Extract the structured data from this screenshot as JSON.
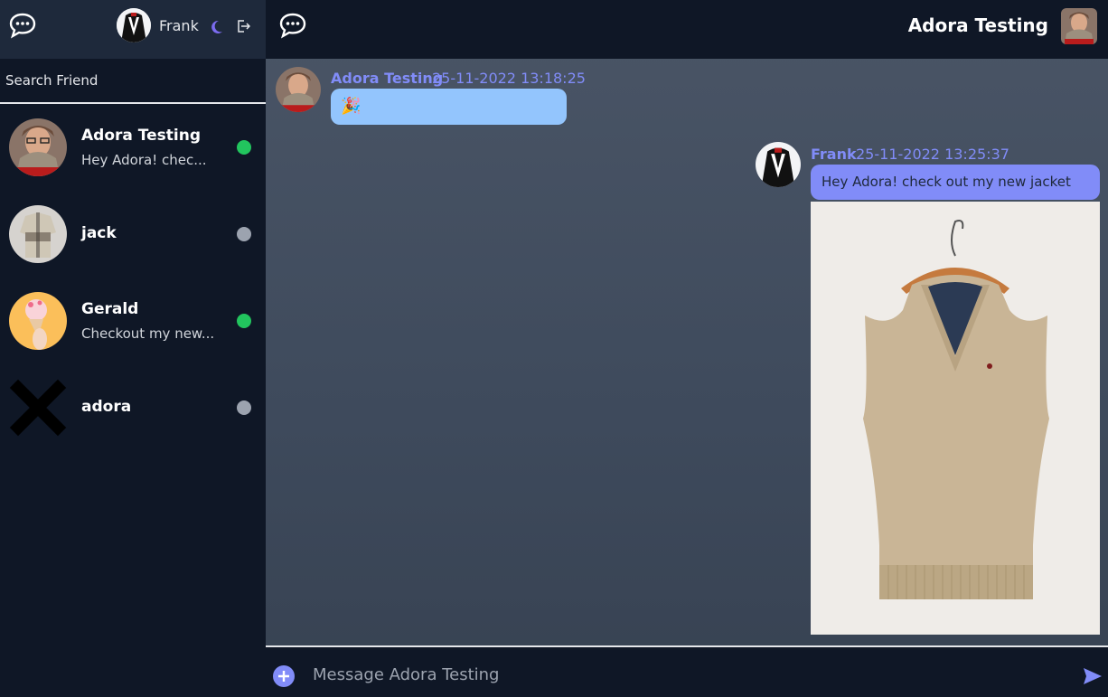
{
  "current_user": {
    "name": "Frank"
  },
  "search": {
    "placeholder": "Search Friend"
  },
  "contacts": [
    {
      "name": "Adora Testing",
      "preview": "Hey Adora! chec...",
      "status": "online"
    },
    {
      "name": "jack",
      "preview": "",
      "status": "offline"
    },
    {
      "name": "Gerald",
      "preview": "Checkout my new...",
      "status": "online"
    },
    {
      "name": "adora",
      "preview": "",
      "status": "offline"
    }
  ],
  "chat": {
    "title": "Adora Testing",
    "messages": [
      {
        "sender": "Adora Testing",
        "time": "25-11-2022 13:18:25",
        "text": "🎉",
        "direction": "incoming"
      },
      {
        "sender": "Frank",
        "time": "25-11-2022 13:25:37",
        "text": "Hey Adora! check out my new jacket",
        "direction": "outgoing",
        "attachment": "sweater-vest-photo"
      }
    ]
  },
  "composer": {
    "placeholder": "Message Adora Testing"
  },
  "colors": {
    "accent": "#818cf8",
    "online": "#22c55e",
    "offline": "#9ca3af",
    "incoming_bubble": "#93c5fd"
  },
  "icons": [
    "chat-bubble-logo-icon",
    "moon-icon",
    "logout-icon",
    "plus-icon",
    "send-icon"
  ]
}
